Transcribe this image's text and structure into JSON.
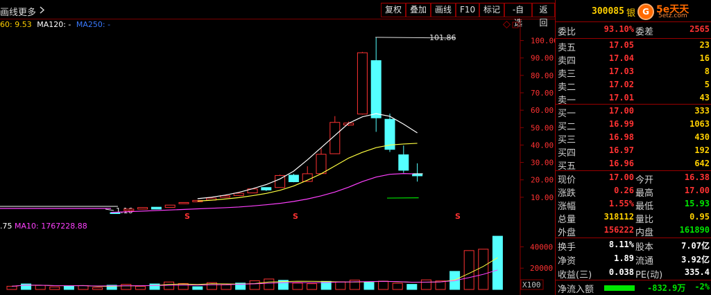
{
  "toolbar": {
    "left_label": "画线",
    "more_label": "更多",
    "more_icon": "chevron-right-icon",
    "buttons": [
      "复权",
      "叠加",
      "画线",
      "F10",
      "标记",
      "-自选",
      "返回"
    ]
  },
  "indicator": {
    "ma60": "60: 9.53",
    "ma120": "MA120: -",
    "ma250": "MA250: -"
  },
  "volume_indicator": {
    "vol": ".75",
    "ma10": "MA10: 1767228.88"
  },
  "price_axis": [
    "100.00",
    "90.00",
    "80.00",
    "70.00",
    "60.00",
    "50.00",
    "40.00",
    "30.00",
    "20.00",
    "10.00"
  ],
  "volume_axis": [
    "40000",
    "20000",
    "X100"
  ],
  "annotations": {
    "high_label": "101.86",
    "low_label": "1.16"
  },
  "colors": {
    "up": "#ff3232",
    "down": "#54ffff",
    "ma5": "#ffffff",
    "ma10": "#ffff40",
    "ma20": "#ff40ff",
    "ma60": "#00e000",
    "grid": "#8b0000"
  },
  "chart_data": {
    "type": "candlestick",
    "price_panel": {
      "ylim": [
        0,
        105
      ],
      "candles": [
        {
          "o": 1.2,
          "c": 1.16,
          "h": 1.25,
          "l": 1.1
        },
        {
          "o": 2.3,
          "c": 3.2,
          "h": 3.3,
          "l": 2.2
        },
        {
          "o": 3.2,
          "c": 4.1,
          "h": 4.2,
          "l": 3.1
        },
        {
          "o": 4.3,
          "c": 3.2,
          "h": 4.4,
          "l": 3.1
        },
        {
          "o": 4.2,
          "c": 5.5,
          "h": 5.6,
          "l": 4.1
        },
        {
          "o": 6.3,
          "c": 7.0,
          "h": 7.1,
          "l": 6.2
        },
        {
          "o": 7.4,
          "c": 8.2,
          "h": 8.3,
          "l": 7.3
        },
        {
          "o": 8.4,
          "c": 9.5,
          "h": 9.6,
          "l": 8.3
        },
        {
          "o": 10.0,
          "c": 10.9,
          "h": 11.0,
          "l": 9.9
        },
        {
          "o": 11.0,
          "c": 12.3,
          "h": 12.4,
          "l": 10.9
        },
        {
          "o": 12.5,
          "c": 14.8,
          "h": 15.0,
          "l": 12.4
        },
        {
          "o": 15.6,
          "c": 14.2,
          "h": 15.7,
          "l": 13.6
        },
        {
          "o": 15.6,
          "c": 22.5,
          "h": 23.0,
          "l": 15.5
        },
        {
          "o": 22.7,
          "c": 18.9,
          "h": 23.5,
          "l": 18.6
        },
        {
          "o": 19.1,
          "c": 23.5,
          "h": 27.8,
          "l": 18.9
        },
        {
          "o": 23.6,
          "c": 34.7,
          "h": 38.0,
          "l": 23.4
        },
        {
          "o": 35.0,
          "c": 53.0,
          "h": 56.6,
          "l": 34.8
        },
        {
          "o": 51.5,
          "c": 52.6,
          "h": 53.5,
          "l": 51.0
        },
        {
          "o": 57.8,
          "c": 93.0,
          "h": 93.5,
          "l": 57.5
        },
        {
          "o": 88.5,
          "c": 55.6,
          "h": 101.86,
          "l": 47.6
        },
        {
          "o": 54.8,
          "c": 37.5,
          "h": 58.0,
          "l": 36.0
        },
        {
          "o": 34.4,
          "c": 25.5,
          "h": 39.7,
          "l": 24.0
        },
        {
          "o": 23.5,
          "c": 22.3,
          "h": 29.5,
          "l": 19.0
        }
      ],
      "ma5": [
        9.2,
        10.0,
        11.2,
        12.8,
        14.9,
        17.3,
        20.5,
        25.0,
        31.5,
        38.5,
        45.5,
        52.5,
        56.2,
        58.0,
        56.5,
        52.0,
        47.0
      ],
      "ma10": [
        7.8,
        8.3,
        9.0,
        9.8,
        10.9,
        12.2,
        14.0,
        16.5,
        19.8,
        23.5,
        28.0,
        32.5,
        35.8,
        38.5,
        40.0,
        40.6,
        41.0
      ],
      "ma20": [
        4.0,
        4.4,
        5.0,
        5.7,
        6.5,
        7.6,
        9.0,
        10.8,
        13.0,
        15.8,
        19.0,
        21.6,
        23.2,
        23.6,
        23.4
      ],
      "ma60": [
        9.53,
        9.7
      ]
    },
    "volume_panel": {
      "ylim": [
        0,
        52000
      ],
      "values": [
        3000,
        5200,
        3800,
        2400,
        3200,
        3600,
        1800,
        4000,
        4800,
        3000,
        5200,
        7000,
        5600,
        2600,
        6400,
        4400,
        6000,
        8200,
        9800,
        8600,
        6000,
        5400,
        7600,
        7200,
        8800,
        6600,
        7800,
        5800,
        4800,
        9000,
        8000,
        17000,
        36500,
        37800,
        50000
      ]
    }
  },
  "info": {
    "code": "300085",
    "name": "银",
    "logo_glyph": "G",
    "logo_text": "5e天天",
    "logo_domain": "5etz.com",
    "webi_label": "委比",
    "webi_value": "93.10%",
    "wecha_label": "委差",
    "wecha_value": "2565",
    "asks": [
      {
        "label": "卖五",
        "price": "17.05",
        "vol": "23"
      },
      {
        "label": "卖四",
        "price": "17.04",
        "vol": "16"
      },
      {
        "label": "卖三",
        "price": "17.03",
        "vol": "8"
      },
      {
        "label": "卖二",
        "price": "17.02",
        "vol": "5"
      },
      {
        "label": "卖一",
        "price": "17.01",
        "vol": "43"
      }
    ],
    "bids": [
      {
        "label": "买一",
        "price": "17.00",
        "vol": "333"
      },
      {
        "label": "买二",
        "price": "16.99",
        "vol": "1063"
      },
      {
        "label": "买三",
        "price": "16.98",
        "vol": "430"
      },
      {
        "label": "买四",
        "price": "16.97",
        "vol": "192"
      },
      {
        "label": "买五",
        "price": "16.96",
        "vol": "642"
      }
    ],
    "stats": [
      {
        "l1": "现价",
        "v1": "17.00",
        "l2": "今开",
        "v2": "16.38"
      },
      {
        "l1": "涨跌",
        "v1": "0.26",
        "l2": "最高",
        "v2": "17.00"
      },
      {
        "l1": "涨幅",
        "v1": "1.55%",
        "l2": "最低",
        "v2": "15.93"
      },
      {
        "l1": "总量",
        "v1": "318112",
        "l2": "量比",
        "v2": "0.95"
      },
      {
        "l1": "外盘",
        "v1": "156222",
        "l2": "内盘",
        "v2": "161890"
      }
    ],
    "fund": [
      {
        "l1": "换手",
        "v1": "8.11%",
        "l2": "股本",
        "v2": "7.07亿"
      },
      {
        "l1": "净资",
        "v1": "1.89",
        "l2": "流通",
        "v2": "3.92亿"
      },
      {
        "l1": "收益(三)",
        "v1": "0.038",
        "l2": "PE(动)",
        "v2": "335.4"
      }
    ],
    "netflow_label": "净流入额",
    "netflow_value": "-832.9万",
    "netflow_pct": "-2%"
  }
}
